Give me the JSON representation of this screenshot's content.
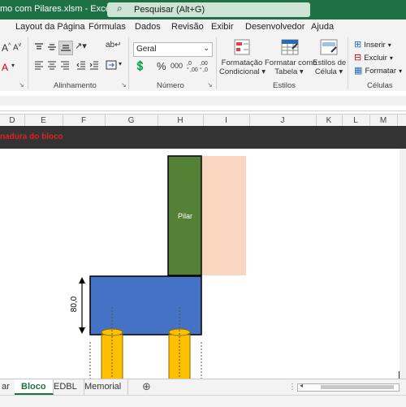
{
  "titlebar": {
    "title": "mo com  Pilares.xlsm  -  Excel",
    "search_placeholder": "Pesquisar (Alt+G)"
  },
  "tabs": [
    "Layout da Página",
    "Fórmulas",
    "Dados",
    "Revisão",
    "Exibir",
    "Desenvolvedor",
    "Ajuda"
  ],
  "ribbon": {
    "groups": {
      "alignment": "Alinhamento",
      "number": "Número",
      "styles": "Estilos",
      "cells": "Células"
    },
    "number_format": "Geral",
    "percent_symbol": "%",
    "thousands_symbol": "000",
    "inc_decimal": "←,0 ,00",
    "dec_decimal": ",00 →,0",
    "styles_buttons": {
      "conditional_1": "Formatação",
      "conditional_2": "Condicional",
      "table_1": "Formatar como",
      "table_2": "Tabela",
      "cellstyles_1": "Estilos de",
      "cellstyles_2": "Célula"
    },
    "cells_buttons": {
      "insert": "Inserir",
      "delete": "Excluir",
      "format": "Formatar"
    }
  },
  "columns": [
    "D",
    "E",
    "F",
    "G",
    "H",
    "I",
    "J",
    "K",
    "L",
    "M"
  ],
  "banner": "nadura do bloco",
  "drawing": {
    "pillar_label": "Pilar",
    "dimension_label": "80,0",
    "colors": {
      "pillar": "#538135",
      "block": "#4472c4",
      "piles": "#ffc000",
      "shadow": "#f8d6c0"
    }
  },
  "sheet_tabs": [
    "ar",
    "Bloco",
    "EDBL",
    "Memorial"
  ],
  "active_sheet": "Bloco"
}
